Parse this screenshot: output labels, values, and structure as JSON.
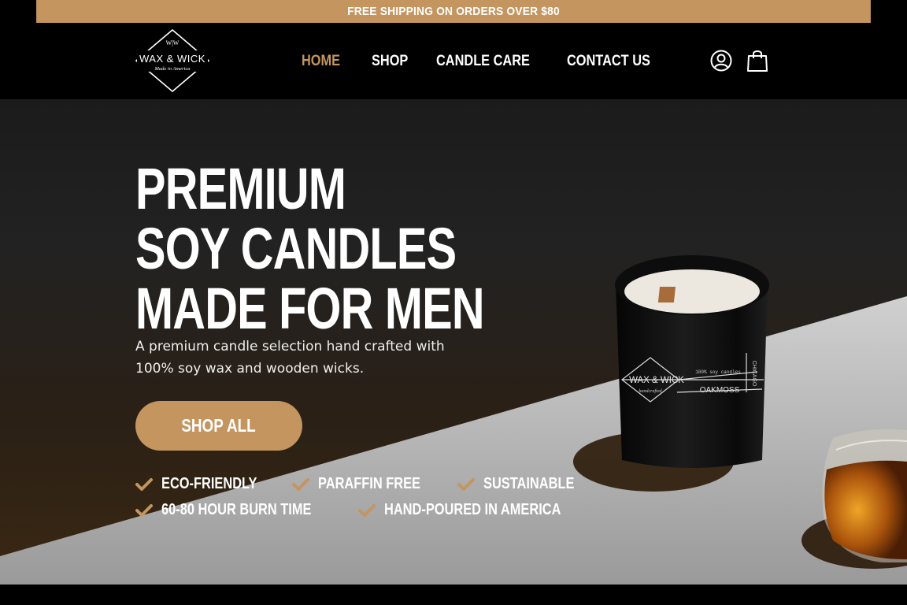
{
  "promo": {
    "text": "FREE SHIPPING ON ORDERS OVER $80"
  },
  "logo": {
    "monogram": "W|W",
    "brand": "WAX & WICK",
    "tagline": "Made in America"
  },
  "nav": {
    "items": [
      {
        "label": "HOME",
        "active": true
      },
      {
        "label": "SHOP",
        "active": false
      },
      {
        "label": "CANDLE CARE",
        "active": false
      },
      {
        "label": "CONTACT US",
        "active": false
      }
    ]
  },
  "header_icons": {
    "account": "user-circle-icon",
    "cart": "shopping-bag-icon"
  },
  "hero": {
    "title_lines": [
      "PREMIUM",
      "SOY CANDLES",
      "MADE FOR MEN"
    ],
    "subtitle": "A premium candle selection hand crafted with 100% soy wax and wooden wicks.",
    "cta": "SHOP ALL",
    "features": [
      [
        "ECO-FRIENDLY",
        "PARAFFIN FREE",
        "SUSTAINABLE"
      ],
      [
        "60-80 HOUR BURN TIME",
        "HAND-POURED IN AMERICA"
      ]
    ],
    "candle_label": {
      "brand": "WAX & WICK",
      "sub": "handcrafted",
      "type": "100% soy candles",
      "scent": "OAKMOSS",
      "city": "CHICAGO"
    }
  },
  "colors": {
    "accent": "#c4955f",
    "header_bg": "#000000",
    "text": "#ffffff"
  }
}
